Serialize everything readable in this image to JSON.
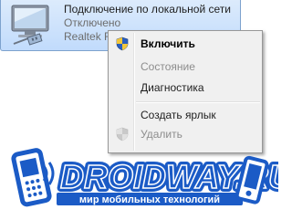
{
  "connection": {
    "name": "Подключение по локальной сети",
    "status": "Отключено",
    "adapter": "Realtek R",
    "icon": "network-adapter-icon"
  },
  "context_menu": {
    "items": [
      {
        "label": "Включить",
        "icon": "uac-shield-icon",
        "default": true,
        "enabled": true
      },
      {
        "label": "Состояние",
        "enabled": false
      },
      {
        "label": "Диагностика",
        "enabled": true
      },
      {
        "label": "Создать ярлык",
        "enabled": true
      },
      {
        "label": "Удалить",
        "icon": "uac-shield-icon",
        "enabled": false
      }
    ]
  },
  "watermark": {
    "logo_text": "DROIDWAY.RU",
    "tagline": "мир мобильных технологий"
  },
  "colors": {
    "selection_background": "#c9e0fc",
    "selection_border": "#7da2ce",
    "menu_background": "#f0f0f0",
    "disabled_text": "#8d8d8d",
    "logo_blue": "#1b5bc6"
  }
}
